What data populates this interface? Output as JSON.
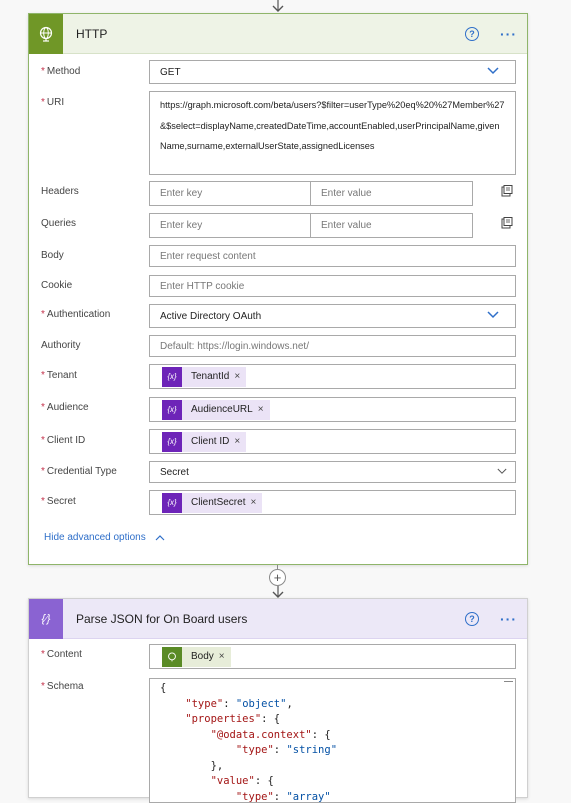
{
  "http_card": {
    "title": "HTTP",
    "help_icon": "?",
    "more_icon": "···",
    "fields": {
      "method": {
        "label": "Method",
        "value": "GET",
        "required": true
      },
      "uri": {
        "label": "URI",
        "value": "https://graph.microsoft.com/beta/users?$filter=userType%20eq%20%27Member%27&$select=displayName,createdDateTime,accountEnabled,userPrincipalName,givenName,surname,externalUserState,assignedLicenses",
        "required": true
      },
      "headers": {
        "label": "Headers",
        "key_placeholder": "Enter key",
        "value_placeholder": "Enter value"
      },
      "queries": {
        "label": "Queries",
        "key_placeholder": "Enter key",
        "value_placeholder": "Enter value"
      },
      "body": {
        "label": "Body",
        "placeholder": "Enter request content"
      },
      "cookie": {
        "label": "Cookie",
        "placeholder": "Enter HTTP cookie"
      },
      "authentication": {
        "label": "Authentication",
        "value": "Active Directory OAuth",
        "required": true
      },
      "authority": {
        "label": "Authority",
        "placeholder": "Default: https://login.windows.net/"
      },
      "tenant": {
        "label": "Tenant",
        "token": "TenantId",
        "required": true
      },
      "audience": {
        "label": "Audience",
        "token": "AudienceURL",
        "required": true
      },
      "client_id": {
        "label": "Client ID",
        "token": "Client ID",
        "required": true
      },
      "credential_type": {
        "label": "Credential Type",
        "value": "Secret",
        "required": true
      },
      "secret": {
        "label": "Secret",
        "token": "ClientSecret",
        "required": true
      }
    },
    "advanced_link": "Hide advanced options"
  },
  "parse_card": {
    "title": "Parse JSON for On Board users",
    "help_icon": "?",
    "more_icon": "···",
    "fields": {
      "content": {
        "label": "Content",
        "token": "Body",
        "required": true
      },
      "schema": {
        "label": "Schema",
        "required": true
      }
    }
  },
  "token_icon_text": "{x}",
  "token_close": "×",
  "required_mark": "*",
  "add_step": "+",
  "colors": {
    "http_accent": "#709727",
    "parse_accent": "#8a63d2",
    "variable_token": "#6d24b8",
    "link": "#2f6fc9",
    "required": "#c4314b"
  }
}
